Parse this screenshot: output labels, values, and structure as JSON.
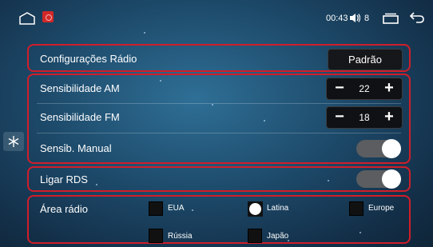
{
  "status_bar": {
    "time": "00:43",
    "volume_level": "8",
    "icons": [
      "home-icon",
      "app-icon",
      "volume-icon",
      "recent-apps-icon",
      "back-icon"
    ]
  },
  "side_handle": {
    "icon": "snowflake-icon"
  },
  "settings": {
    "radio_config": {
      "label": "Configurações Rádio",
      "button": "Padrão"
    },
    "am_sensitivity": {
      "label": "Sensibilidade AM",
      "value": "22",
      "minus": "−",
      "plus": "+"
    },
    "fm_sensitivity": {
      "label": "Sensibilidade FM",
      "value": "18",
      "minus": "−",
      "plus": "+"
    },
    "manual_sensitivity": {
      "label": "Sensib. Manual",
      "enabled": true
    },
    "rds": {
      "label": "Ligar RDS",
      "enabled": true
    },
    "radio_area": {
      "label": "Área rádio",
      "options": [
        {
          "label": "EUA",
          "selected": false
        },
        {
          "label": "Latina",
          "selected": true
        },
        {
          "label": "Europe",
          "selected": false
        },
        {
          "label": "Rússia",
          "selected": false
        },
        {
          "label": "Japão",
          "selected": false
        }
      ]
    }
  },
  "colors": {
    "highlight_border": "#d01e2a",
    "background": "#1d4a6a",
    "control_dark": "#101114",
    "toggle_track": "#5b5d60"
  }
}
